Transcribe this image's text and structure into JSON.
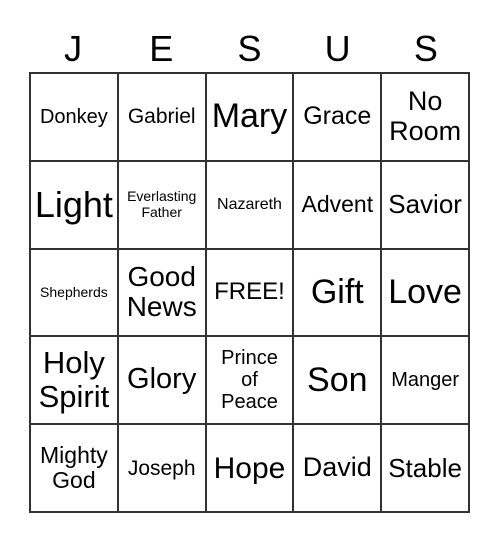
{
  "header": [
    "J",
    "E",
    "S",
    "U",
    "S"
  ],
  "cells": [
    "Donkey",
    "Gabriel",
    "Mary",
    "Grace",
    "No\nRoom",
    "Light",
    "Everlasting\nFather",
    "Nazareth",
    "Advent",
    "Savior",
    "Shepherds",
    "Good\nNews",
    "FREE!",
    "Gift",
    "Love",
    "Holy\nSpirit",
    "Glory",
    "Prince\nof\nPeace",
    "Son",
    "Manger",
    "Mighty\nGod",
    "Joseph",
    "Hope",
    "David",
    "Stable"
  ]
}
